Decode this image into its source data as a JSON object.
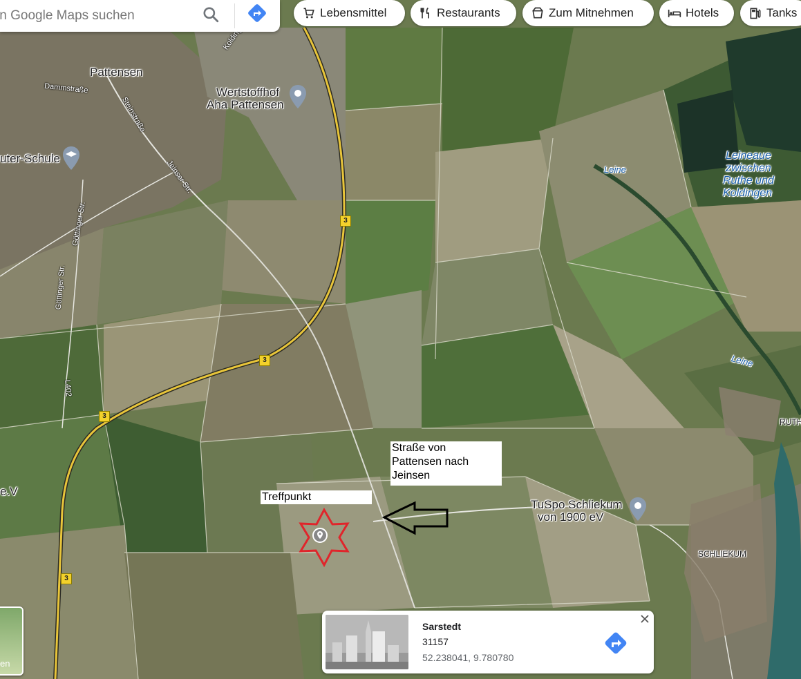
{
  "search": {
    "placeholder": "In Google Maps suchen"
  },
  "chips": [
    {
      "label": "Lebensmittel",
      "icon": "cart-icon"
    },
    {
      "label": "Restaurants",
      "icon": "fork-knife-icon"
    },
    {
      "label": "Zum Mitnehmen",
      "icon": "takeout-icon"
    },
    {
      "label": "Hotels",
      "icon": "bed-icon"
    },
    {
      "label": "Tanks",
      "icon": "fuel-icon"
    }
  ],
  "map": {
    "places": {
      "pattensen": "Pattensen",
      "wertstoffhof_1": "Wertstoffhof",
      "wertstoffhof_2": "Aha Pattensen",
      "schule": "uter-Schule",
      "leineaue_1": "Leineaue",
      "leineaue_2": "zwischen",
      "leineaue_3": "Ruthe und",
      "leineaue_4": "Koldingen",
      "leine_1": "Leine",
      "leine_2": "Leine",
      "tuspo_1": "TuSpo Schliekum",
      "tuspo_2": "von 1900 eV",
      "schliekum": "SCHLIEKUM",
      "ruth": "RUTH",
      "ev": "e.V"
    },
    "streets": {
      "dammstrasse": "Dammstraße",
      "steinstrasse": "Steinstraße",
      "jeinser": "Jeinser Str.",
      "goettinger_1": "Göttinger Str.",
      "goettinger_2": "Göttinger Str.",
      "l402": "L402",
      "koldinger": "Kolding"
    },
    "road_number": "3",
    "layer_label": "en"
  },
  "annotations": {
    "treffpunkt": "Treffpunkt",
    "strasse_1": "Straße von",
    "strasse_2": "Pattensen nach",
    "strasse_3": "Jeinsen"
  },
  "infocard": {
    "title": "Sarstedt",
    "postcode": "31157",
    "coords": "52.238041, 9.780780"
  },
  "colors": {
    "accent_blue": "#4285f4",
    "road_yellow": "#e8c53a",
    "marker_red": "#e0252b"
  }
}
